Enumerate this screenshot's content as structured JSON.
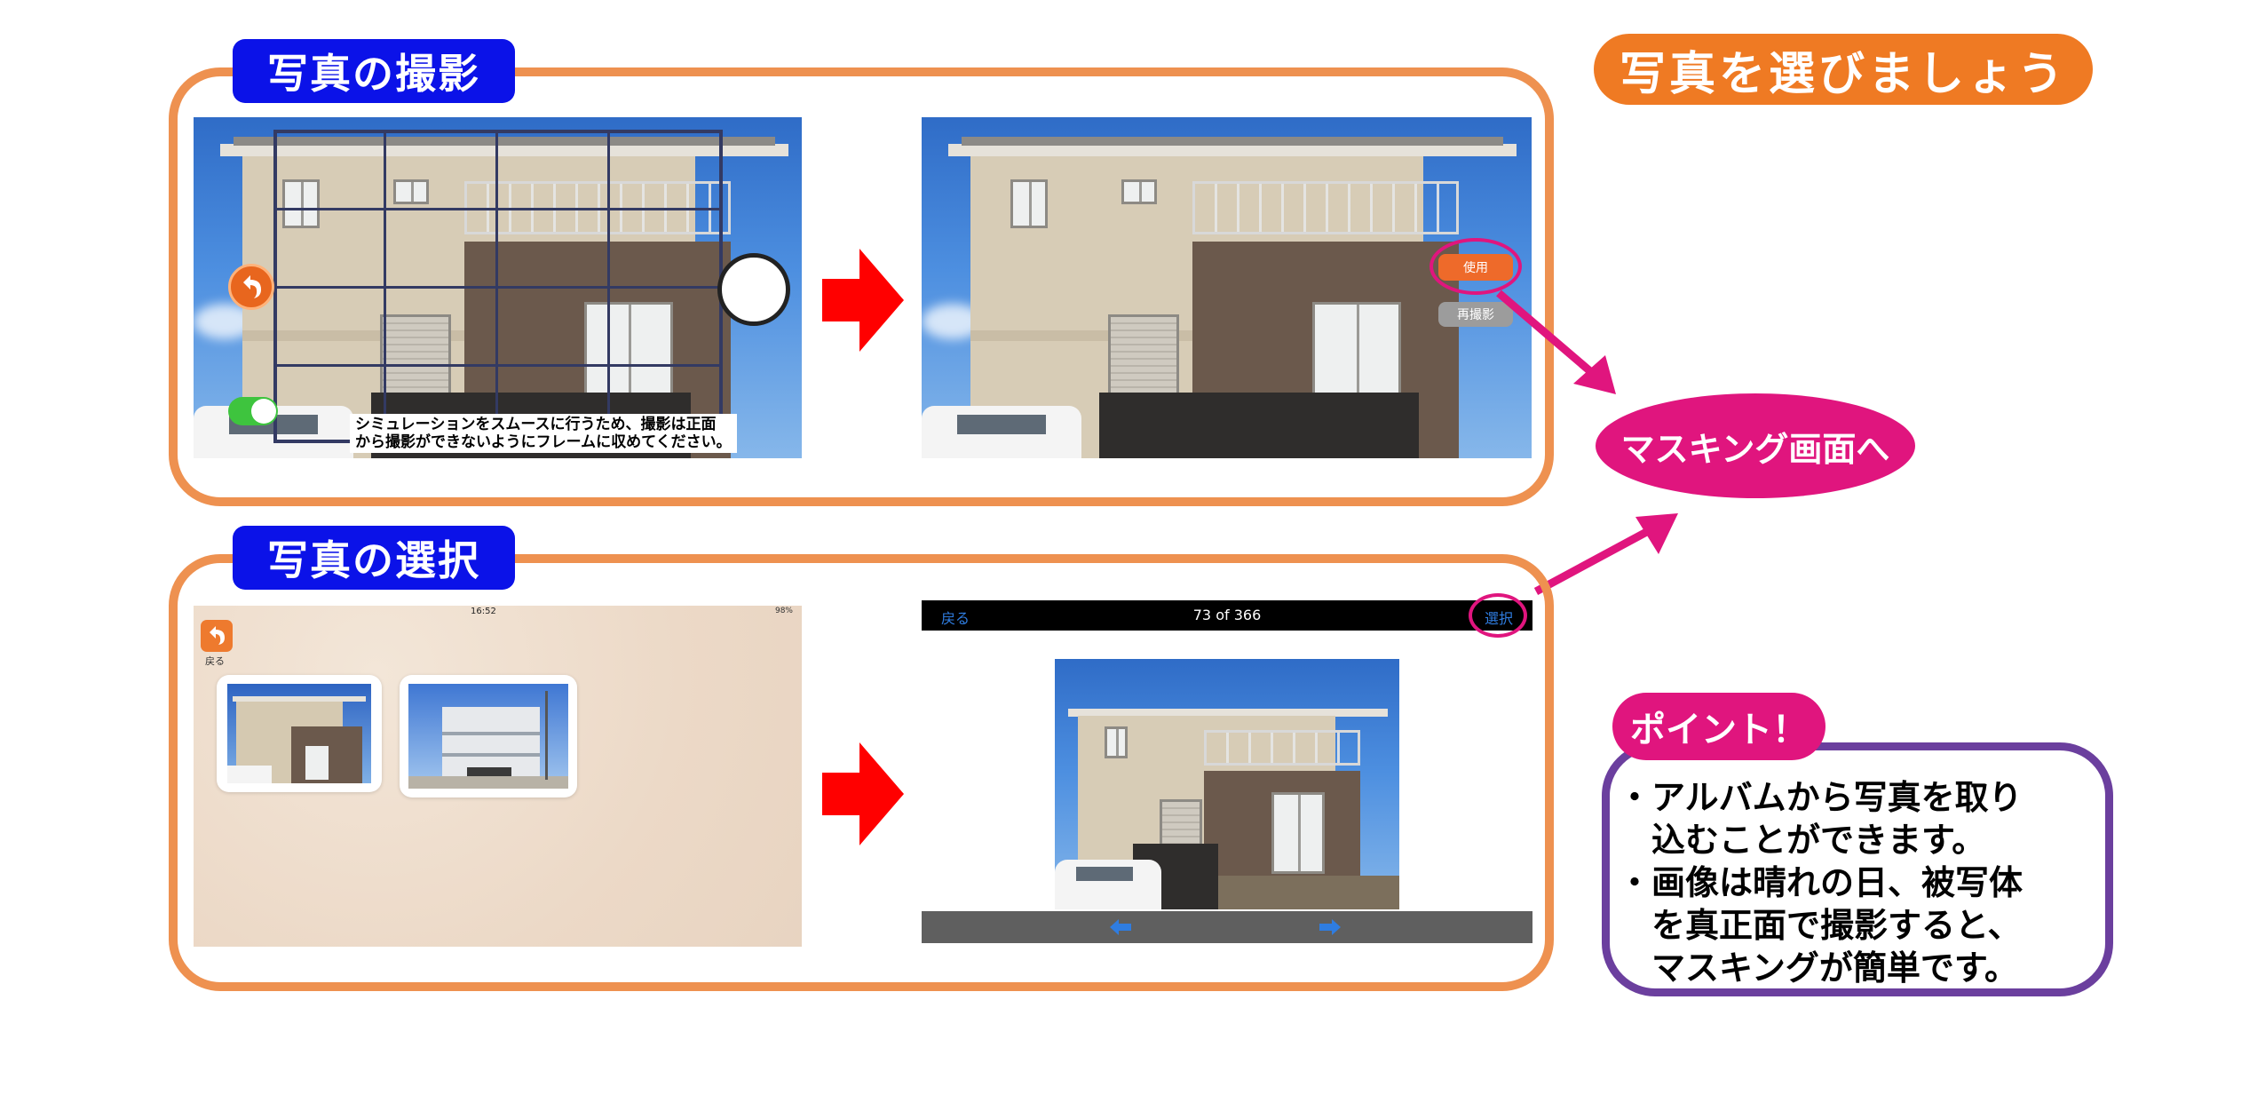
{
  "title_pill": "写真を選びましょう",
  "section_capture": {
    "tab": "写真の撮影",
    "camera_caption_line1": "シミュレーションをスムースに行うため、撮影は正面",
    "camera_caption_line2": "から撮影ができないようにフレームに収めてください。",
    "use_button": "使用",
    "retake_button": "再撮影"
  },
  "section_select": {
    "tab": "写真の選択",
    "status_time": "16:52",
    "status_battery": "98%",
    "back_label": "戻る",
    "viewer_back": "戻る",
    "viewer_counter": "73 of 366",
    "viewer_select": "選択"
  },
  "masking_pill": "マスキング画面へ",
  "point": {
    "tab": "ポイント！",
    "line1": "・アルバムから写真を取り",
    "line2": "込むことができます。",
    "line3": "・画像は晴れの日、被写体",
    "line4": "を真正面で撮影すると、",
    "line5": "マスキングが簡単です。"
  },
  "colors": {
    "orange_frame": "#ee9150",
    "tab_blue": "#0b12e8",
    "magenta": "#e0157e",
    "purple": "#6b3f9e",
    "title_orange": "#ef7a23",
    "red_arrow": "#ff0000",
    "ios_blue": "#2f7de1"
  }
}
